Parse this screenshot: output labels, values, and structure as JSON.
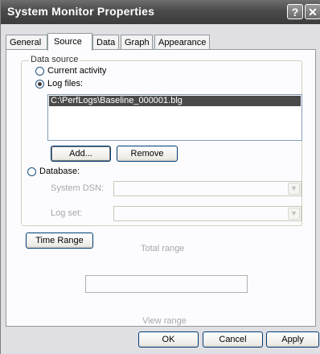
{
  "window": {
    "title": "System Monitor Properties"
  },
  "titlebar_buttons": {
    "help": "?",
    "close": "✕"
  },
  "tabs": [
    {
      "label": "General"
    },
    {
      "label": "Source"
    },
    {
      "label": "Data"
    },
    {
      "label": "Graph"
    },
    {
      "label": "Appearance"
    }
  ],
  "active_tab": "Source",
  "data_source": {
    "group_label": "Data source",
    "current_activity_label": "Current activity",
    "log_files_label": "Log files:",
    "selected": "Log files:",
    "log_file_items": [
      "C:\\PerfLogs\\Baseline_000001.blg"
    ],
    "add_label": "Add...",
    "remove_label": "Remove",
    "database_label": "Database:",
    "system_dsn_label": "System DSN:",
    "log_set_label": "Log set:"
  },
  "time_range": {
    "button_label": "Time Range",
    "total_range_label": "Total range",
    "view_range_label": "View range"
  },
  "footer": {
    "ok_label": "OK",
    "cancel_label": "Cancel",
    "apply_label": "Apply"
  }
}
